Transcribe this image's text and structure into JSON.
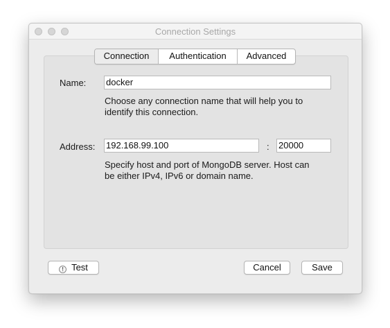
{
  "window": {
    "title": "Connection Settings"
  },
  "tabs": [
    {
      "label": "Connection",
      "selected": true
    },
    {
      "label": "Authentication",
      "selected": false
    },
    {
      "label": "Advanced",
      "selected": false
    }
  ],
  "name_section": {
    "label": "Name:",
    "value": "docker",
    "hint_line1": "Choose any connection name that will help you to",
    "hint_line2": "identify this connection."
  },
  "address_section": {
    "label": "Address:",
    "host_value": "192.168.99.100",
    "separator": ":",
    "port_value": "20000",
    "hint_line1": "Specify host and port of MongoDB server. Host can",
    "hint_line2": "be either IPv4, IPv6 or domain name."
  },
  "buttons": {
    "test_label": "Test",
    "test_icon_glyph": "!",
    "cancel_label": "Cancel",
    "save_label": "Save"
  },
  "icons": {
    "test": "exclamation-circle-icon"
  },
  "colors": {
    "window_bg": "#ececec",
    "panel_bg": "#e3e3e3",
    "title_text": "#a8a8a8"
  }
}
